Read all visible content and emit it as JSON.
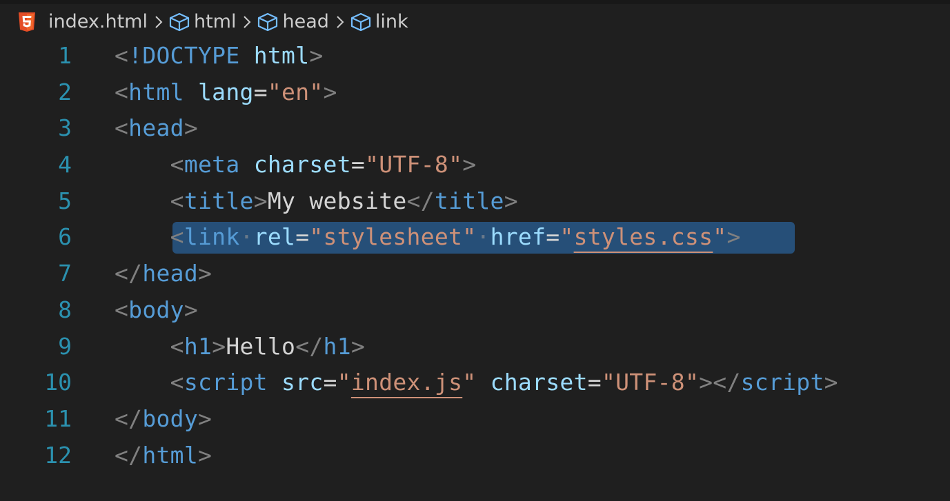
{
  "breadcrumb": {
    "file": "index.html",
    "items": [
      "html",
      "head",
      "link"
    ]
  },
  "icons": {
    "file": "html5-icon",
    "element": "cube-icon",
    "separator": "chevron-right-icon"
  },
  "colors": {
    "background": "#1f1f1f",
    "line_number": "#2b91af",
    "tag": "#569cd6",
    "attribute": "#9cdcfe",
    "string": "#ce9178",
    "punctuation": "#808080",
    "text": "#d4d4d4",
    "selection": "#264f78",
    "html5_orange": "#e44d26"
  },
  "editor": {
    "selected_line": 6,
    "lines": [
      {
        "num": "1",
        "tokens": {
          "open": "<",
          "doctype": "!DOCTYPE",
          "sp": " ",
          "name": "html",
          "close": ">"
        }
      },
      {
        "num": "2",
        "tokens": {
          "open": "<",
          "tag": "html",
          "sp": " ",
          "attr": "lang",
          "eq": "=",
          "q1": "\"",
          "val": "en",
          "q2": "\"",
          "close": ">"
        }
      },
      {
        "num": "3",
        "tokens": {
          "open": "<",
          "tag": "head",
          "close": ">"
        }
      },
      {
        "num": "4",
        "tokens": {
          "indent": "    ",
          "open": "<",
          "tag": "meta",
          "sp": " ",
          "attr": "charset",
          "eq": "=",
          "q1": "\"",
          "val": "UTF-8",
          "q2": "\"",
          "close": ">"
        }
      },
      {
        "num": "5",
        "tokens": {
          "indent": "    ",
          "open": "<",
          "tag": "title",
          "close": ">",
          "text": "My website",
          "open2": "</",
          "tag2": "title",
          "close2": ">"
        }
      },
      {
        "num": "6",
        "tokens": {
          "indent": "    ",
          "open": "<",
          "tag": "link",
          "dot1": "·",
          "attr1": "rel",
          "eq1": "=",
          "q1": "\"",
          "val1": "stylesheet",
          "q2": "\"",
          "dot2": "·",
          "attr2": "href",
          "eq2": "=",
          "q3": "\"",
          "val2": "styles.css",
          "q4": "\"",
          "close": ">"
        }
      },
      {
        "num": "7",
        "tokens": {
          "open": "</",
          "tag": "head",
          "close": ">"
        }
      },
      {
        "num": "8",
        "tokens": {
          "open": "<",
          "tag": "body",
          "close": ">"
        }
      },
      {
        "num": "9",
        "tokens": {
          "indent": "    ",
          "open": "<",
          "tag": "h1",
          "close": ">",
          "text": "Hello",
          "open2": "</",
          "tag2": "h1",
          "close2": ">"
        }
      },
      {
        "num": "10",
        "tokens": {
          "indent": "    ",
          "open": "<",
          "tag": "script",
          "sp1": " ",
          "attr1": "src",
          "eq1": "=",
          "q1": "\"",
          "val1": "index.js",
          "q2": "\"",
          "sp2": " ",
          "attr2": "charset",
          "eq2": "=",
          "q3": "\"",
          "val2": "UTF-8",
          "q4": "\"",
          "close": ">",
          "open2": "</",
          "tag2": "script",
          "close2": ">"
        }
      },
      {
        "num": "11",
        "tokens": {
          "open": "</",
          "tag": "body",
          "close": ">"
        }
      },
      {
        "num": "12",
        "tokens": {
          "open": "</",
          "tag": "html",
          "close": ">"
        }
      }
    ]
  }
}
